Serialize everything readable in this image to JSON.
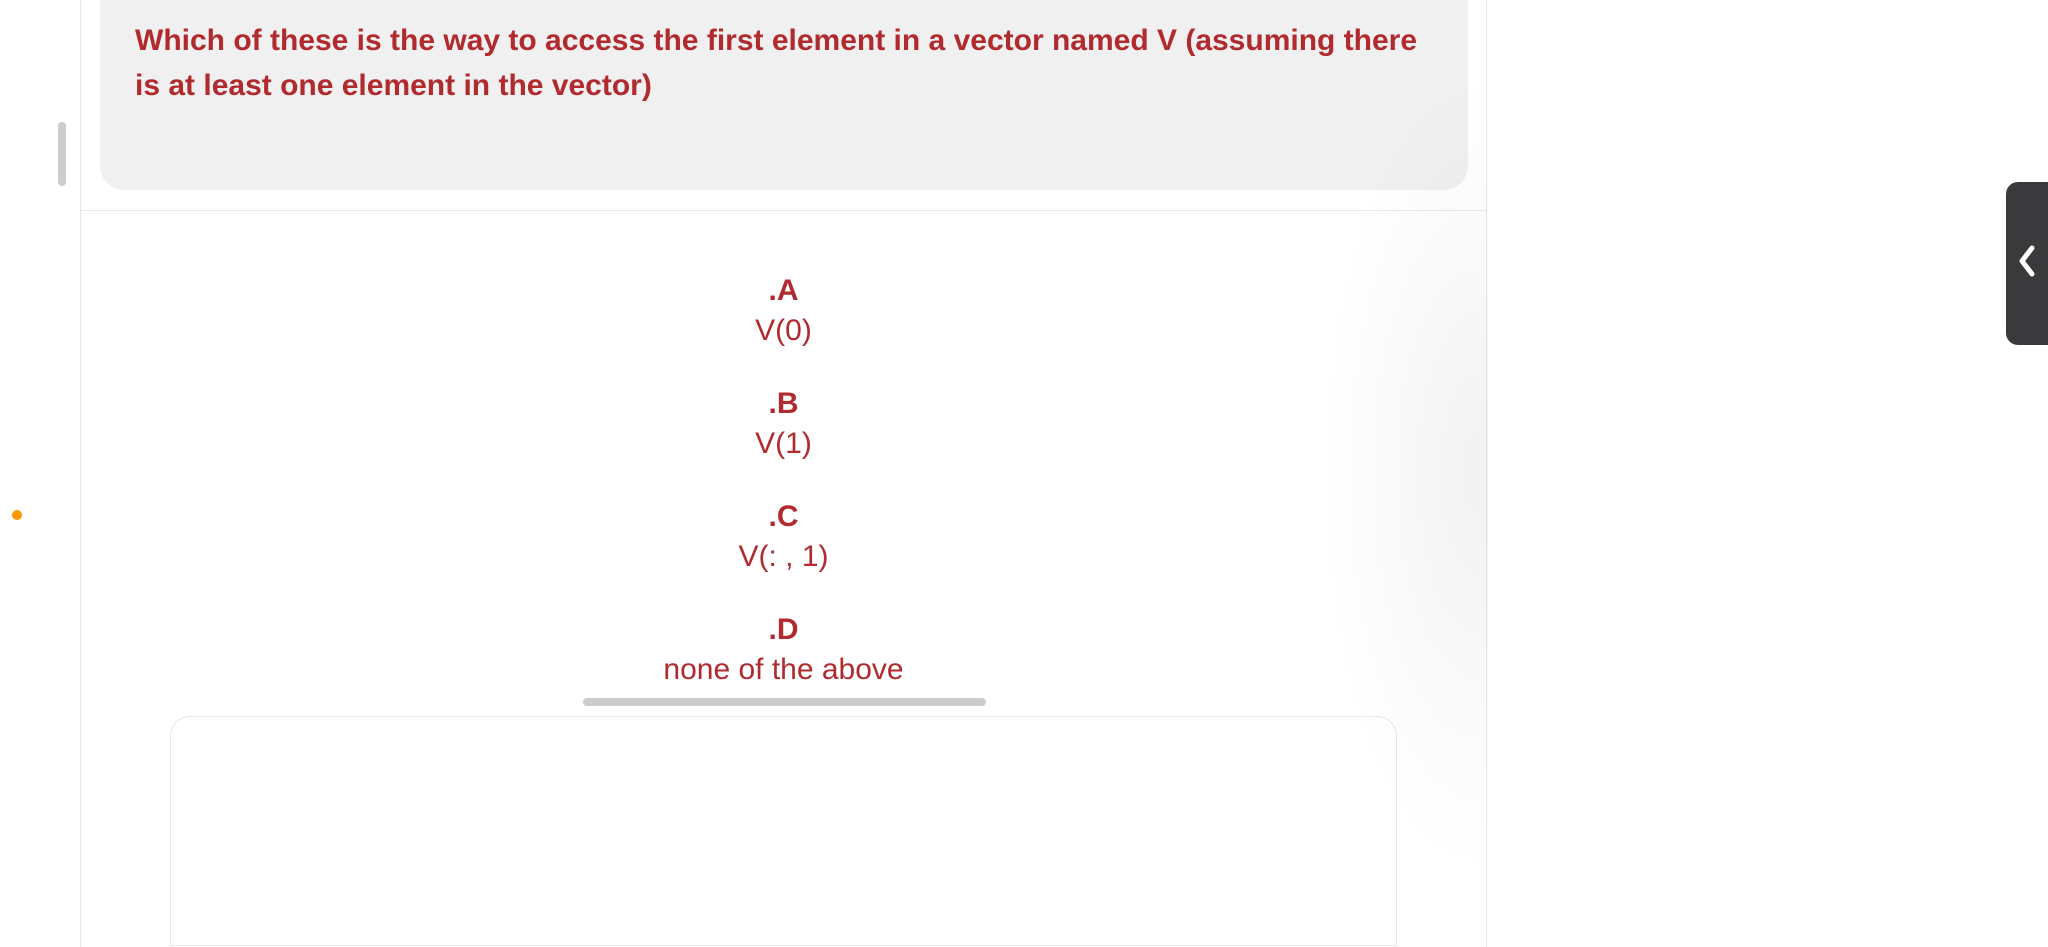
{
  "question": {
    "text": "Which of these is the way to access the first element in a vector named V (assuming there is at least one element in the vector)"
  },
  "options": [
    {
      "label": ".A",
      "text": "V(0)"
    },
    {
      "label": ".B",
      "text": "V(1)"
    },
    {
      "label": ".C",
      "text": "V(: , 1)"
    },
    {
      "label": ".D",
      "text": "none of the above"
    }
  ]
}
